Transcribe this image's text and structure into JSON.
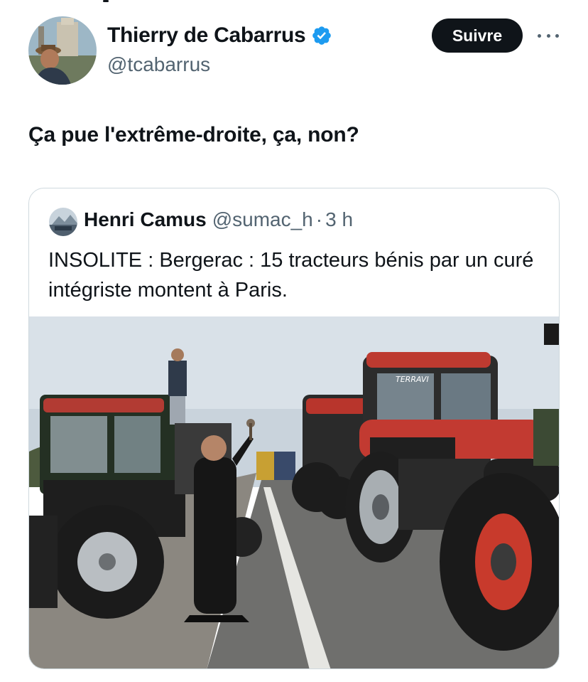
{
  "author": {
    "display_name": "Thierry de Cabarrus",
    "handle": "@tcabarrus",
    "verified_icon": "verified-badge-icon",
    "verified_color": "#1d9bf0"
  },
  "actions": {
    "follow_label": "Suivre",
    "more_icon": "more-horizontal-icon"
  },
  "tweet": {
    "text": "Ça pue l'extrême-droite, ça, non?"
  },
  "quoted_tweet": {
    "display_name": "Henri Camus",
    "handle": "@sumac_h",
    "separator": "·",
    "time": "3 h",
    "text": "INSOLITE : Bergerac : 15 tracteurs bénis par un curé intégriste montent à Paris.",
    "media": {
      "description": "photo",
      "tractor_label": "TERRAVI"
    }
  },
  "colors": {
    "text_primary": "#0f1419",
    "text_secondary": "#536471",
    "border": "#cfd9de",
    "button_bg": "#0f1419"
  }
}
